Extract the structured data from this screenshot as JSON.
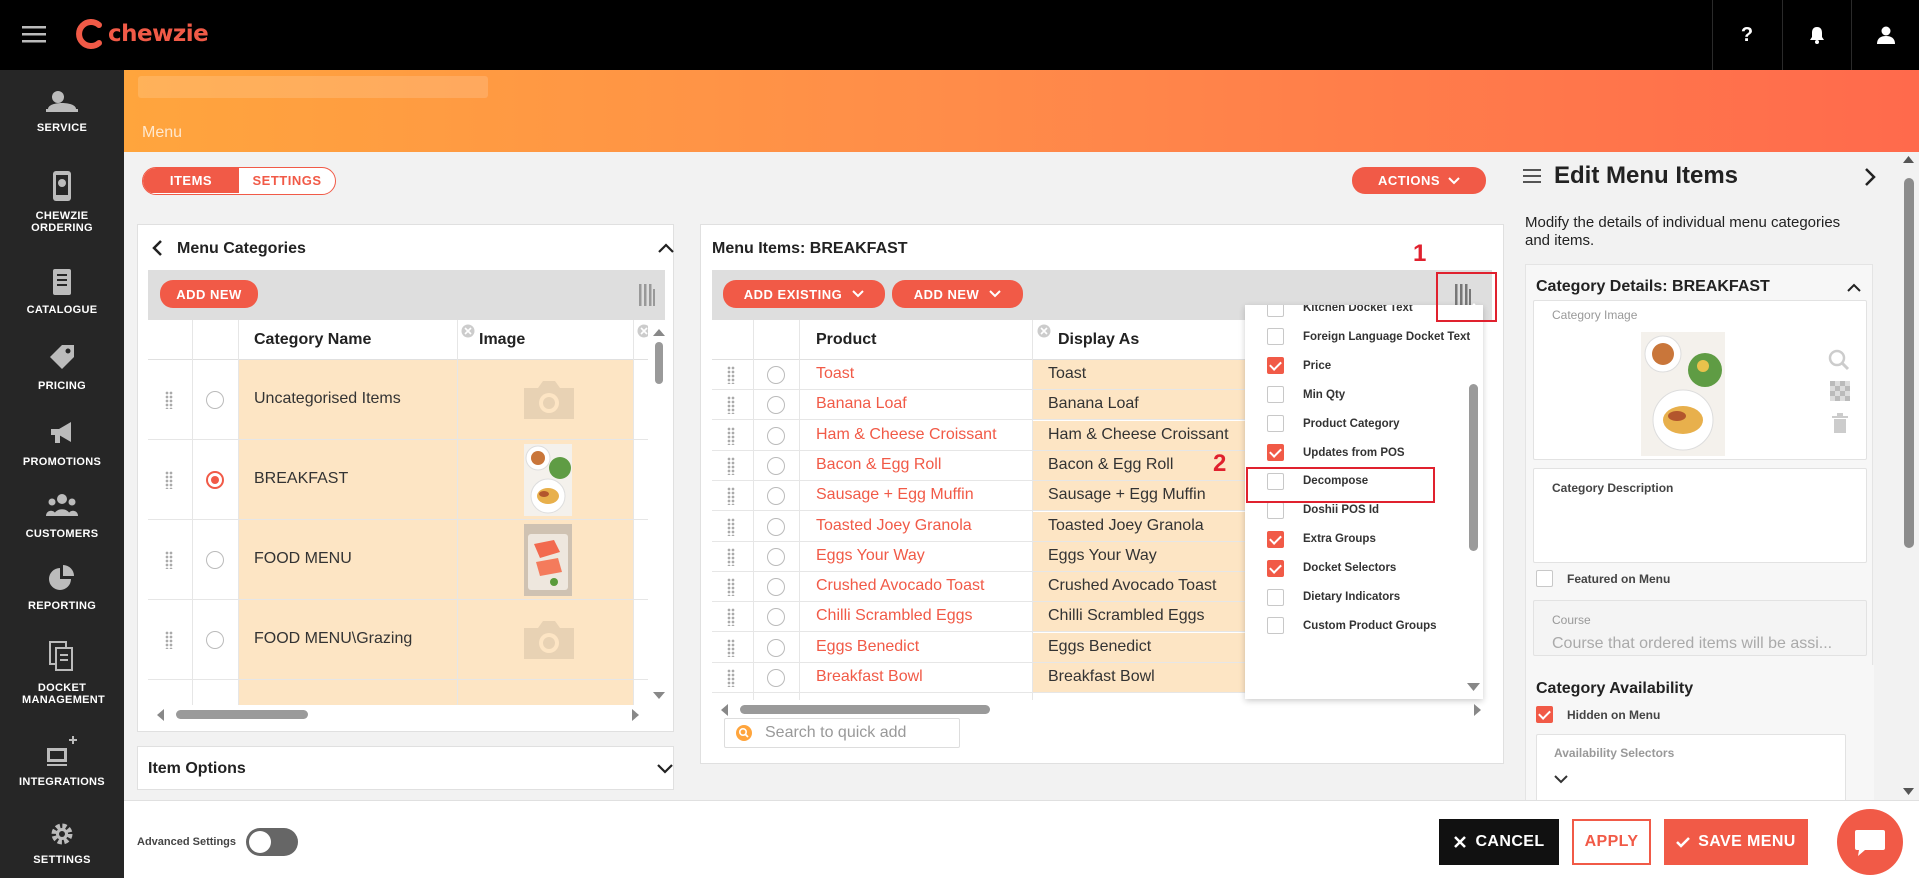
{
  "app": {
    "brand": "chewzie",
    "brand_color": "#f15a47",
    "help_label": "?"
  },
  "nav": {
    "items": [
      {
        "label": "SERVICE",
        "icon": "service-bell-icon"
      },
      {
        "label": "CHEWZIE ORDERING",
        "icon": "mobile-ordering-icon"
      },
      {
        "label": "CATALOGUE",
        "icon": "catalogue-book-icon"
      },
      {
        "label": "PRICING",
        "icon": "price-tag-icon"
      },
      {
        "label": "PROMOTIONS",
        "icon": "megaphone-icon"
      },
      {
        "label": "CUSTOMERS",
        "icon": "customers-group-icon"
      },
      {
        "label": "REPORTING",
        "icon": "pie-chart-icon"
      },
      {
        "label": "DOCKET MANAGEMENT",
        "icon": "dockets-icon"
      },
      {
        "label": "INTEGRATIONS",
        "icon": "integrations-icon"
      },
      {
        "label": "SETTINGS",
        "icon": "gear-icon"
      }
    ]
  },
  "banner": {
    "title": "Menu"
  },
  "tabs": {
    "items": "ITEMS",
    "settings": "SETTINGS"
  },
  "actions_label": "ACTIONS",
  "categories": {
    "title": "Menu Categories",
    "add_new": "ADD NEW",
    "columns": {
      "name": "Category Name",
      "image": "Image"
    },
    "rows": [
      {
        "name": "Uncategorised Items",
        "image": "placeholder",
        "selected": false
      },
      {
        "name": "BREAKFAST",
        "image": "breakfast-photo",
        "selected": true
      },
      {
        "name": "FOOD MENU",
        "image": "salmon-photo",
        "selected": false
      },
      {
        "name": "FOOD MENU\\Grazing",
        "image": "placeholder",
        "selected": false
      }
    ]
  },
  "item_options": {
    "title": "Item Options"
  },
  "menu_items": {
    "title": "Menu Items: BREAKFAST",
    "add_existing": "ADD EXISTING",
    "add_new": "ADD NEW",
    "columns": {
      "product": "Product",
      "display_as": "Display As"
    },
    "rows": [
      {
        "product": "Toast",
        "display": "Toast"
      },
      {
        "product": "Banana Loaf",
        "display": "Banana Loaf"
      },
      {
        "product": "Ham & Cheese Croissant",
        "display": "Ham & Cheese Croissant"
      },
      {
        "product": "Bacon & Egg Roll",
        "display": "Bacon & Egg Roll"
      },
      {
        "product": "Sausage + Egg Muffin",
        "display": "Sausage + Egg Muffin"
      },
      {
        "product": "Toasted Joey Granola",
        "display": "Toasted Joey Granola"
      },
      {
        "product": "Eggs Your Way",
        "display": "Eggs Your Way"
      },
      {
        "product": "Crushed Avocado Toast",
        "display": "Crushed Avocado Toast"
      },
      {
        "product": "Chilli Scrambled Eggs",
        "display": "Chilli Scrambled Eggs"
      },
      {
        "product": "Eggs Benedict",
        "display": "Eggs Benedict"
      },
      {
        "product": "Breakfast Bowl",
        "display": "Breakfast Bowl"
      }
    ],
    "quick_add_placeholder": "Search to quick add"
  },
  "column_chooser": {
    "items": [
      {
        "label": "Kitchen Docket Text",
        "checked": false
      },
      {
        "label": "Foreign Language Docket Text",
        "checked": false
      },
      {
        "label": "Price",
        "checked": true
      },
      {
        "label": "Min Qty",
        "checked": false
      },
      {
        "label": "Product Category",
        "checked": false
      },
      {
        "label": "Updates from POS",
        "checked": true
      },
      {
        "label": "Decompose",
        "checked": false
      },
      {
        "label": "Doshii POS Id",
        "checked": false
      },
      {
        "label": "Extra Groups",
        "checked": true
      },
      {
        "label": "Docket Selectors",
        "checked": true
      },
      {
        "label": "Dietary Indicators",
        "checked": false
      },
      {
        "label": "Custom Product Groups",
        "checked": false
      }
    ]
  },
  "annotations": {
    "one": "1",
    "two": "2"
  },
  "edit_panel": {
    "title": "Edit Menu Items",
    "description": "Modify the details of individual menu categories and items.",
    "category_details_title": "Category Details: BREAKFAST",
    "category_image_label": "Category Image",
    "category_description_label": "Category Description",
    "featured_label": "Featured on Menu",
    "course_label": "Course",
    "course_placeholder": "Course that ordered items will be assi...",
    "availability_title": "Category Availability",
    "hidden_label": "Hidden on Menu",
    "availability_selectors_label": "Availability Selectors"
  },
  "footer": {
    "advanced_settings": "Advanced Settings",
    "cancel": "CANCEL",
    "apply": "APPLY",
    "save_menu": "SAVE MENU"
  }
}
